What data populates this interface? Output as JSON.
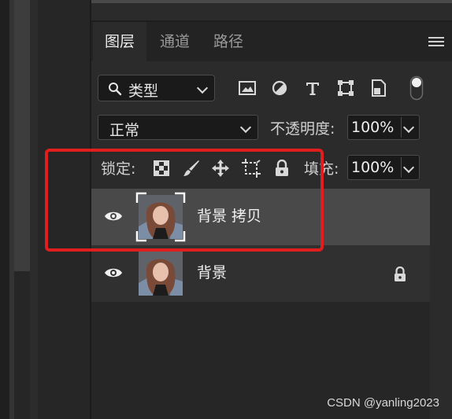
{
  "tabs": [
    {
      "label": "图层",
      "active": true
    },
    {
      "label": "通道",
      "active": false
    },
    {
      "label": "路径",
      "active": false
    }
  ],
  "filter": {
    "kind_label": "类型",
    "icons": [
      "image-filter-icon",
      "adjustment-filter-icon",
      "type-filter-icon",
      "shape-filter-icon",
      "smart-object-filter-icon",
      "filter-toggle-icon"
    ]
  },
  "blend": {
    "mode": "正常",
    "opacity_label": "不透明度:",
    "opacity_value": "100%"
  },
  "lock": {
    "label": "锁定:",
    "icons": [
      "lock-transparent-pixels-icon",
      "lock-image-pixels-icon",
      "lock-position-icon",
      "lock-artboard-icon",
      "lock-all-icon"
    ],
    "fill_label": "填充:",
    "fill_value": "100%"
  },
  "layers": [
    {
      "name": "背景 拷贝",
      "visible": true,
      "selected": true,
      "locked": false
    },
    {
      "name": "背景",
      "visible": true,
      "selected": false,
      "locked": true
    }
  ],
  "watermark": "CSDN @yanling2023",
  "colors": {
    "highlight_box": "#e01e1e",
    "panel_bg": "#2b2b2b",
    "selected_layer_bg": "#494949"
  }
}
